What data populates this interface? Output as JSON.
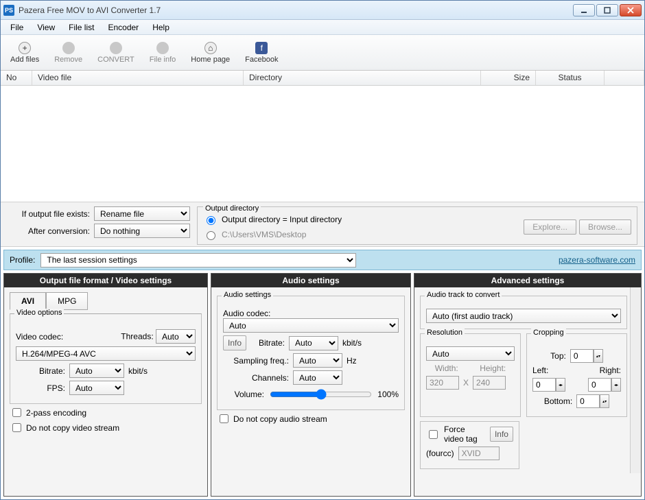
{
  "title": "Pazera Free MOV to AVI Converter 1.7",
  "appicon": "PS",
  "menu": [
    "File",
    "View",
    "File list",
    "Encoder",
    "Help"
  ],
  "toolbar": [
    {
      "label": "Add files",
      "icon": "plus",
      "enabled": true
    },
    {
      "label": "Remove",
      "icon": "dot",
      "enabled": false
    },
    {
      "label": "CONVERT",
      "icon": "dot",
      "enabled": false
    },
    {
      "label": "File info",
      "icon": "dot",
      "enabled": false
    },
    {
      "label": "Home page",
      "icon": "home",
      "enabled": true
    },
    {
      "label": "Facebook",
      "icon": "fb",
      "enabled": true
    }
  ],
  "columns": {
    "no": "No",
    "video": "Video file",
    "dir": "Directory",
    "size": "Size",
    "status": "Status"
  },
  "mid": {
    "exists_label": "If output file exists:",
    "exists_value": "Rename file",
    "after_label": "After conversion:",
    "after_value": "Do nothing",
    "outdir_legend": "Output directory",
    "outdir_same": "Output directory = Input directory",
    "outdir_path": "C:\\Users\\VMS\\Desktop",
    "explore": "Explore...",
    "browse": "Browse..."
  },
  "profile": {
    "label": "Profile:",
    "value": "The last session settings",
    "link": "pazera-software.com"
  },
  "video": {
    "head": "Output file format / Video settings",
    "tab_avi": "AVI",
    "tab_mpg": "MPG",
    "options_legend": "Video options",
    "codec_label": "Video codec:",
    "codec_value": "H.264/MPEG-4 AVC",
    "threads_label": "Threads:",
    "threads_value": "Auto",
    "bitrate_label": "Bitrate:",
    "bitrate_value": "Auto",
    "bitrate_unit": "kbit/s",
    "fps_label": "FPS:",
    "fps_value": "Auto",
    "twopass": "2-pass encoding",
    "nocopy": "Do not copy video stream"
  },
  "audio": {
    "head": "Audio settings",
    "group_legend": "Audio settings",
    "codec_label": "Audio codec:",
    "codec_value": "Auto",
    "info": "Info",
    "bitrate_label": "Bitrate:",
    "bitrate_value": "Auto",
    "bitrate_unit": "kbit/s",
    "samp_label": "Sampling freq.:",
    "samp_value": "Auto",
    "samp_unit": "Hz",
    "chan_label": "Channels:",
    "chan_value": "Auto",
    "vol_label": "Volume:",
    "vol_value": "100%",
    "nocopy": "Do not copy audio stream"
  },
  "adv": {
    "head": "Advanced settings",
    "track_legend": "Audio track to convert",
    "track_value": "Auto (first audio track)",
    "res_legend": "Resolution",
    "res_value": "Auto",
    "width_label": "Width:",
    "width_value": "320",
    "x": "X",
    "height_label": "Height:",
    "height_value": "240",
    "crop_legend": "Cropping",
    "top": "Top:",
    "left": "Left:",
    "right": "Right:",
    "bottom": "Bottom:",
    "zero": "0",
    "force_legend": "Force video tag",
    "info": "Info",
    "fourcc_label": "(fourcc)",
    "fourcc_value": "XVID"
  }
}
